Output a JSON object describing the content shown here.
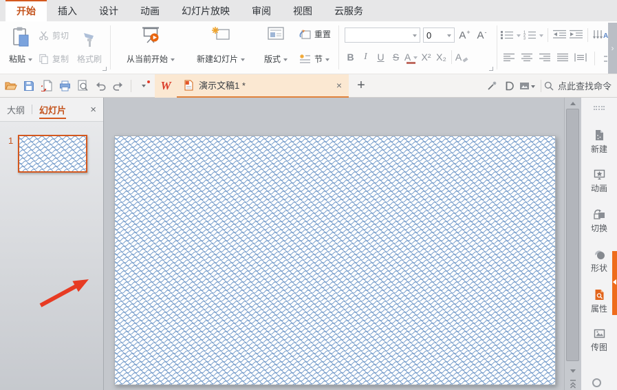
{
  "menu": {
    "tabs": [
      {
        "label": "开始",
        "active": true
      },
      {
        "label": "插入"
      },
      {
        "label": "设计"
      },
      {
        "label": "动画"
      },
      {
        "label": "幻灯片放映"
      },
      {
        "label": "审阅"
      },
      {
        "label": "视图"
      },
      {
        "label": "云服务"
      }
    ]
  },
  "ribbon": {
    "clipboard": {
      "paste": "粘贴",
      "cut": "剪切",
      "copy": "复制",
      "format_painter": "格式刷"
    },
    "slideshow": {
      "from_current": "从当前开始",
      "new_slide": "新建幻灯片",
      "layout": "版式",
      "reset": "重置",
      "section": "节"
    },
    "font": {
      "name_value": "",
      "size_value": "0",
      "bold": "B",
      "italic": "I",
      "underline": "U",
      "strikethrough": "S",
      "color_letter": "A",
      "superscript": "X²",
      "subscript": "X₂",
      "increase_letter": "A",
      "increase_sign": "+",
      "decrease_letter": "A",
      "decrease_sign": "-",
      "clear_letter": "A"
    },
    "expand_chevron": "›"
  },
  "quickbar": {
    "wps_logo_letter": "W",
    "doc_tab_title": "演示文稿1 *",
    "close_glyph": "×",
    "new_tab_glyph": "+",
    "find_hint": "点此查找命令"
  },
  "left_panel": {
    "tab_outline": "大纲",
    "tab_slides": "幻灯片",
    "close_glyph": "×",
    "slide_number": "1"
  },
  "sidebar": {
    "items": [
      {
        "label": "新建"
      },
      {
        "label": "动画"
      },
      {
        "label": "切换"
      },
      {
        "label": "形状"
      },
      {
        "label": "属性",
        "accent": true
      },
      {
        "label": "传图"
      }
    ]
  },
  "colors": {
    "accent": "#d4581e",
    "tab_underline": "#e0813a",
    "pattern_blue": "#7199c9",
    "annotation_red": "#e73b23",
    "panel_indicator": "#ee6c1c"
  }
}
